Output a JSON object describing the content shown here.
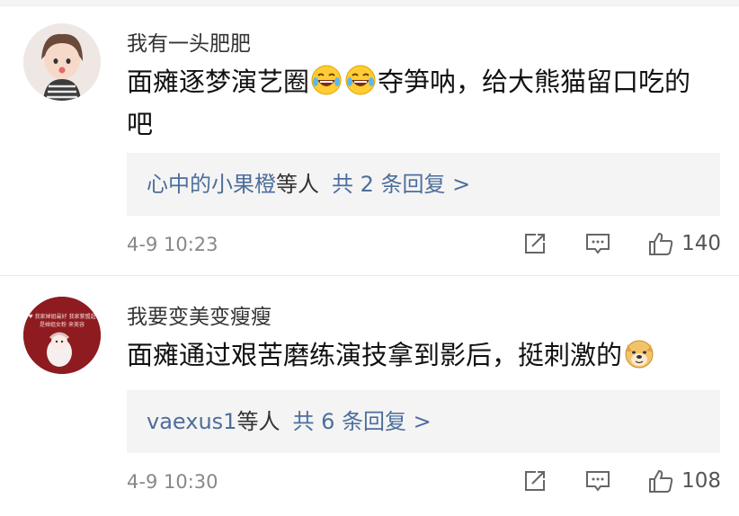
{
  "comments": [
    {
      "username": "我有一头肥肥",
      "text_part1": "面瘫逐梦演艺圈",
      "text_part2": "夺笋呐，给大熊猫留口吃的吧",
      "replies_names": "心中的小果橙",
      "replies_etal": "等人",
      "replies_count": "共 2 条回复 >",
      "time": "4-9 10:23",
      "likes": "140"
    },
    {
      "username": "我要变美变瘦瘦",
      "avatar_text_1": "♥ 我家婵姐最好 我家紫盟超",
      "avatar_text_2": "是婵姐女粉 来美容",
      "text_part1": "面瘫通过艰苦磨练演技拿到影后，挺刺激的",
      "replies_names": "vaexus1",
      "replies_etal": "等人",
      "replies_count": "共 6 条回复 >",
      "time": "4-9 10:30",
      "likes": "108"
    }
  ],
  "colors": {
    "link": "#4d6e9b",
    "meta": "#888888",
    "reply_bg": "#f4f4f4"
  },
  "icons": [
    "repost-icon",
    "comment-icon",
    "like-icon",
    "laugh-cry-emoji",
    "doge-emoji"
  ]
}
